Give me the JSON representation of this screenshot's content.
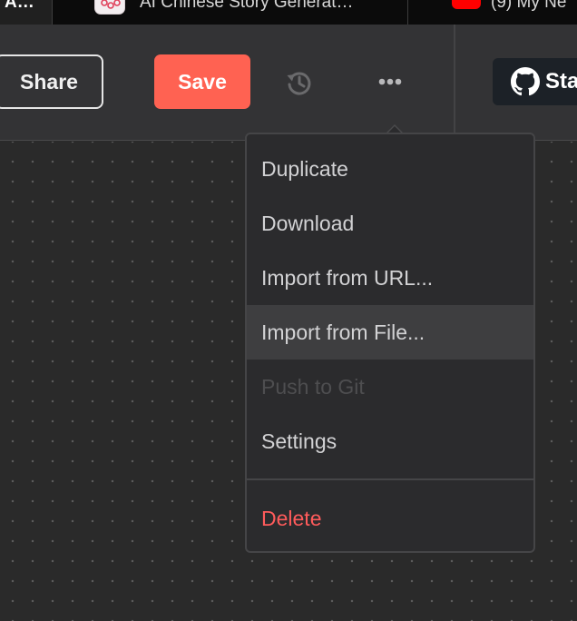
{
  "browser": {
    "tabs": [
      {
        "title": "A…",
        "active": true
      },
      {
        "title": "AI Chinese Story Generat…",
        "favicon": "ai-story-favicon"
      },
      {
        "title": "(9) My Ne",
        "favicon": "youtube-favicon"
      }
    ]
  },
  "toolbar": {
    "share_label": "Share",
    "save_label": "Save",
    "history_icon": "history-icon",
    "more_icon": "more-options-icon",
    "star_label": "Sta",
    "star_icon": "github-icon"
  },
  "menu": {
    "items": [
      {
        "label": "Duplicate",
        "state": "normal"
      },
      {
        "label": "Download",
        "state": "normal"
      },
      {
        "label": "Import from URL...",
        "state": "normal"
      },
      {
        "label": "Import from File...",
        "state": "hover"
      },
      {
        "label": "Push to Git",
        "state": "disabled"
      },
      {
        "label": "Settings",
        "state": "normal"
      }
    ],
    "delete_label": "Delete"
  },
  "colors": {
    "save_button": "#ff6252",
    "delete_text": "#ff5b5b",
    "menu_background": "#2b2b2d",
    "toolbar_background": "#333335",
    "canvas_background": "#2a2a2a"
  }
}
